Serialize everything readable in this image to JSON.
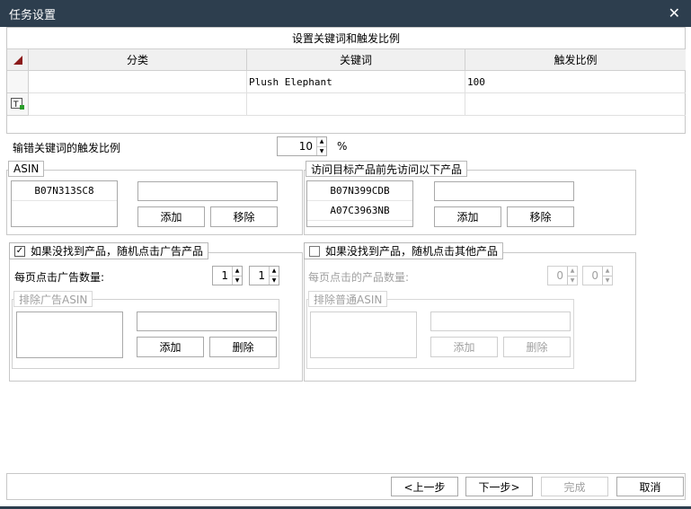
{
  "window": {
    "title": "任务设置",
    "close_glyph": "✕"
  },
  "keyword_grid": {
    "caption": "设置关键词和触发比例",
    "columns": [
      "分类",
      "关键词",
      "触发比例"
    ],
    "rows": [
      {
        "category": "",
        "keyword": "Plush Elephant",
        "ratio": "100"
      }
    ]
  },
  "typo_trigger": {
    "label": "输错关键词的触发比例",
    "value": "10",
    "unit": "%"
  },
  "asin_group": {
    "legend": "ASIN",
    "items": [
      "B07N313SC8"
    ],
    "input_value": "",
    "add_label": "添加",
    "remove_label": "移除"
  },
  "visit_group": {
    "legend": "访问目标产品前先访问以下产品",
    "items": [
      "B07N399CDB",
      "A07C3963NB"
    ],
    "input_value": "",
    "add_label": "添加",
    "remove_label": "移除"
  },
  "ad_group": {
    "checkbox_label": "如果没找到产品，随机点击广告产品",
    "checked": true,
    "per_page_label": "每页点击广告数量:",
    "spin1": "1",
    "spin2": "1",
    "exclude": {
      "legend": "排除广告ASIN",
      "input_value": "",
      "add_label": "添加",
      "delete_label": "删除"
    }
  },
  "other_group": {
    "checkbox_label": "如果没找到产品，随机点击其他产品",
    "checked": false,
    "per_page_label": "每页点击的产品数量:",
    "spin1": "0",
    "spin2": "0",
    "exclude": {
      "legend": "排除普通ASIN",
      "input_value": "",
      "add_label": "添加",
      "delete_label": "删除"
    }
  },
  "footer": {
    "prev": "<上一步",
    "next": "下一步>",
    "finish": "完成",
    "cancel": "取消"
  },
  "colors": {
    "titlebar": "#2d3e4e",
    "border": "#a9a9a9",
    "disabled": "#a0a0a0"
  }
}
